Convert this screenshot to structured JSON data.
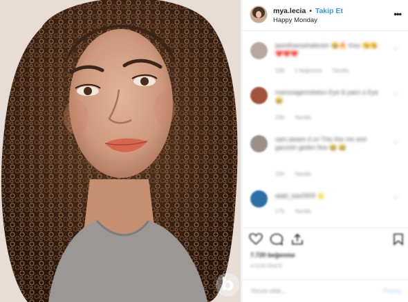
{
  "post": {
    "username": "mya.lecia",
    "separator": "•",
    "follow_label": "Takip Et",
    "location": "Happy Monday",
    "more_icon": "more-options-icon"
  },
  "comments": [
    {
      "text": "jasmfreeswhateverr 😂🔥 Kiss 😘😘 ❤️❤️❤️",
      "meta": [
        "23h",
        "1 beğenme",
        "Yanıtla"
      ],
      "avatar_color": "#b8a79c"
    },
    {
      "text": "marissagemsbeluv Eye & pairs a Eye 😂",
      "meta": [
        "23h",
        "Yanıtla"
      ],
      "avatar_color": "#a0523a"
    },
    {
      "text": "sam.aware d co This this me and ganzish geden fine 😂 😂",
      "meta": [
        "22h",
        "Yanıtla"
      ],
      "avatar_color": "#9b8f88"
    },
    {
      "text": "alakt_kav0909 🌟",
      "meta": [
        "17h",
        "Yanıtla"
      ],
      "avatar_color": "#2f6fa8"
    }
  ],
  "footer": {
    "likes": "7.720 beğenme",
    "date": "4 gün önce",
    "comment_placeholder": "Yorum ekle...",
    "post_button": "Paylaş"
  },
  "photo": {
    "watermark": "b"
  },
  "colors": {
    "accent": "#3897f0",
    "text": "#262626",
    "muted": "#9a9a9a",
    "border": "#efefef"
  }
}
